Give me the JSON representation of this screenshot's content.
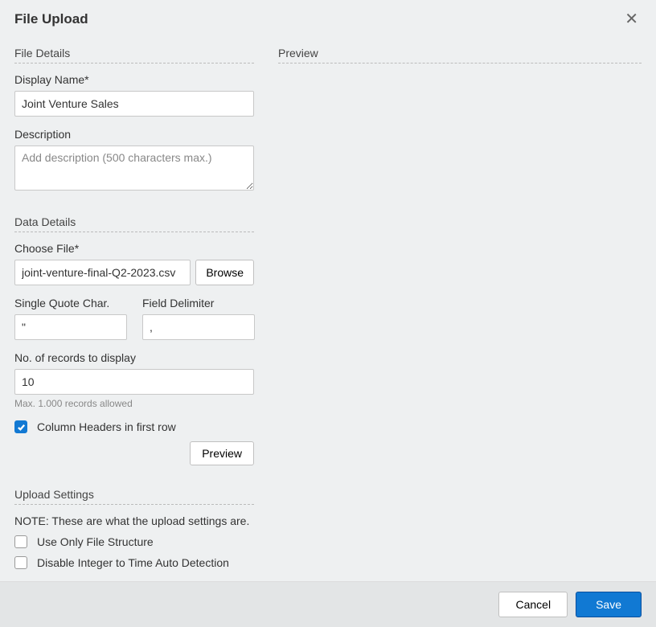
{
  "dialog": {
    "title": "File Upload"
  },
  "sections": {
    "file_details": "File Details",
    "data_details": "Data Details",
    "upload_settings": "Upload Settings",
    "preview": "Preview"
  },
  "fields": {
    "display_name": {
      "label": "Display Name*",
      "value": "Joint Venture Sales"
    },
    "description": {
      "label": "Description",
      "placeholder": "Add description (500 characters max.)",
      "value": ""
    },
    "choose_file": {
      "label": "Choose File*",
      "value": "joint-venture-final-Q2-2023.csv",
      "browse_label": "Browse"
    },
    "quote_char": {
      "label": "Single Quote Char.",
      "value": "\""
    },
    "delimiter": {
      "label": "Field Delimiter",
      "value": ","
    },
    "records": {
      "label": "No. of records to display",
      "value": "10",
      "hint": "Max. 1.000 records allowed"
    },
    "col_headers": {
      "label": "Column Headers in first row",
      "checked": true
    },
    "preview_btn": {
      "label": "Preview"
    },
    "upload_note": "NOTE: These are what the upload settings are.",
    "use_only_structure": {
      "label": "Use Only File Structure",
      "checked": false
    },
    "disable_auto_detect": {
      "label": "Disable Integer to Time Auto Detection",
      "checked": false
    }
  },
  "footer": {
    "cancel": "Cancel",
    "save": "Save"
  }
}
